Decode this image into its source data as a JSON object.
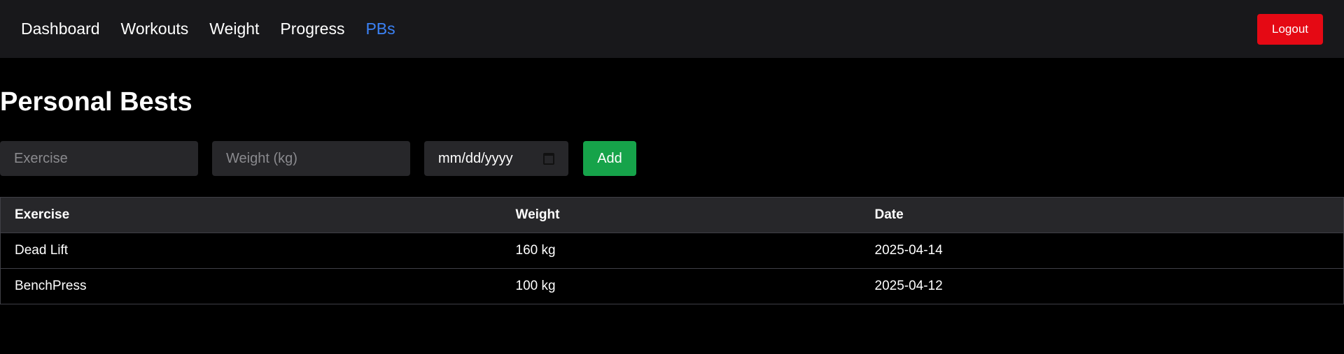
{
  "nav": {
    "links": [
      "Dashboard",
      "Workouts",
      "Weight",
      "Progress",
      "PBs"
    ],
    "active": "PBs",
    "logout_label": "Logout"
  },
  "page": {
    "title": "Personal Bests"
  },
  "form": {
    "exercise_placeholder": "Exercise",
    "weight_placeholder": "Weight (kg)",
    "date_placeholder": "mm/dd/yyyy",
    "add_label": "Add"
  },
  "table": {
    "headers": [
      "Exercise",
      "Weight",
      "Date"
    ],
    "rows": [
      [
        "Dead Lift",
        "160 kg",
        "2025-04-14"
      ],
      [
        "BenchPress",
        "100 kg",
        "2025-04-12"
      ]
    ]
  },
  "colors": {
    "accent": "#3b82f6",
    "logout": "#e50914",
    "add": "#16a34a"
  }
}
